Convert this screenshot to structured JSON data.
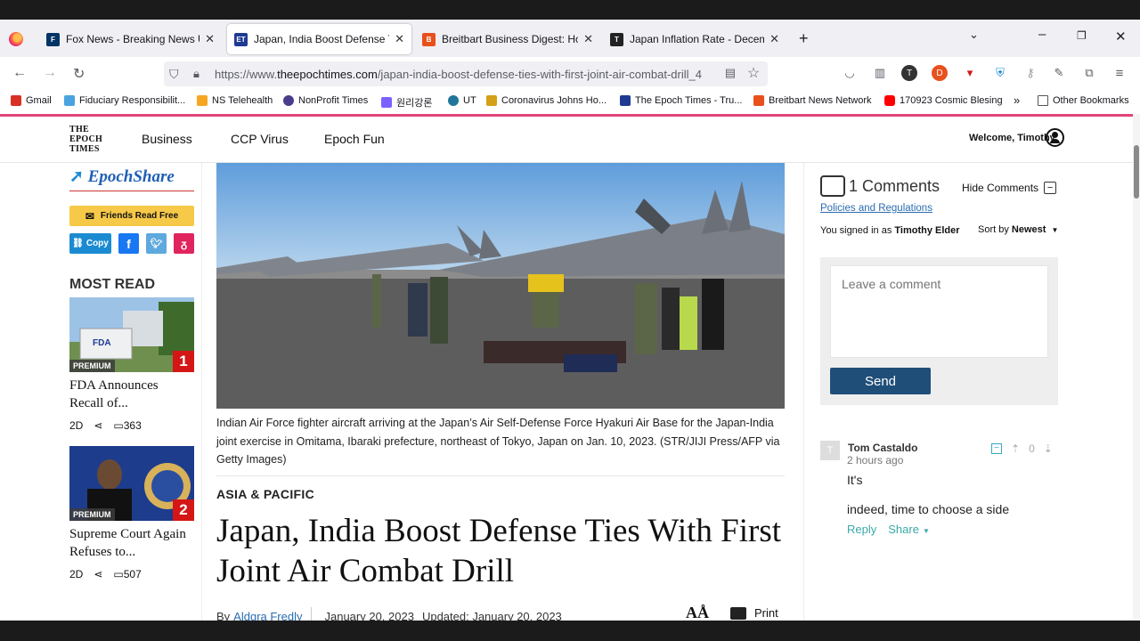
{
  "browser": {
    "tabs": [
      {
        "title": "Fox News - Breaking News Upd",
        "favicon_color": "#003366",
        "active": false
      },
      {
        "title": "Japan, India Boost Defense Ties",
        "favicon_color": "#1f3a93",
        "favicon_text": "ET",
        "active": true
      },
      {
        "title": "Breitbart Business Digest: How",
        "favicon_color": "#e8501c",
        "favicon_text": "B",
        "active": false
      },
      {
        "title": "Japan Inflation Rate - December",
        "favicon_color": "#222222",
        "active": false
      }
    ],
    "url_prefix": "https://www.",
    "url_domain": "theepochtimes.com",
    "url_path": "/japan-india-boost-defense-ties-with-first-joint-air-combat-drill_4",
    "bookmarks": [
      {
        "label": "Gmail",
        "color": "#d93025"
      },
      {
        "label": "Fiduciary Responsibilit...",
        "color": "#4aa3df"
      },
      {
        "label": "NS Telehealth",
        "color": "#f5a623"
      },
      {
        "label": "NonProfit Times",
        "color": "#4a3c8c"
      },
      {
        "label": "원리강론",
        "color": "#7b61ff"
      },
      {
        "label": "UT",
        "color": "#21759b"
      },
      {
        "label": "Coronavirus Johns Ho...",
        "color": "#d4a017"
      },
      {
        "label": "The Epoch Times - Tru...",
        "color": "#1f3a93"
      },
      {
        "label": "Breitbart News Network",
        "color": "#e8501c"
      },
      {
        "label": "170923 Cosmic Blesing",
        "color": "#ff0000"
      }
    ],
    "other_bookmarks": "Other Bookmarks"
  },
  "site": {
    "logo_lines": [
      "THE",
      "EPOCH",
      "TIMES"
    ],
    "nav": [
      "Business",
      "CCP Virus",
      "Epoch Fun"
    ],
    "welcome": "Welcome, Timothy"
  },
  "sidebar": {
    "epochshare": "EpochShare",
    "friends_button": "Friends Read Free",
    "copy_button": "Copy",
    "most_read_title": "MOST READ",
    "items": [
      {
        "badge": "PREMIUM",
        "rank": "1",
        "title": "FDA Announces Recall of...",
        "age": "2D",
        "comments": "363"
      },
      {
        "badge": "PREMIUM",
        "rank": "2",
        "title": "Supreme Court Again Refuses to...",
        "age": "2D",
        "comments": "507"
      }
    ]
  },
  "article": {
    "caption": "Indian Air Force fighter aircraft arriving at the Japan’s Air Self-Defense Force Hyakuri Air Base for the Japan-India joint exercise in Omitama, Ibaraki prefecture, northeast of Tokyo, Japan on Jan. 10, 2023. (STR/JIJI Press/AFP via Getty Images)",
    "section": "ASIA & PACIFIC",
    "headline": "Japan, India Boost Defense Ties With First Joint Air Combat Drill",
    "by_label": "By",
    "author": "Aldgra Fredly",
    "date": "January 20, 2023",
    "updated": "Updated: January 20, 2023",
    "font_size_label": "AÅ",
    "print_label": "Print"
  },
  "comments": {
    "count_label": "1 Comments",
    "hide_label": "Hide Comments",
    "policies_link": "Policies and Regulations",
    "signed_in_prefix": "You signed in as ",
    "signed_in_name": "Timothy Elder",
    "sort_prefix": "Sort by ",
    "sort_value": "Newest",
    "input_placeholder": "Leave a comment",
    "send_label": "Send",
    "items": [
      {
        "avatar": "T",
        "author": "Tom Castaldo",
        "time": "2 hours ago",
        "votes": "0",
        "text_line1": "It's",
        "text_line2": "indeed, time to choose a side",
        "reply_label": "Reply",
        "share_label": "Share"
      }
    ]
  }
}
